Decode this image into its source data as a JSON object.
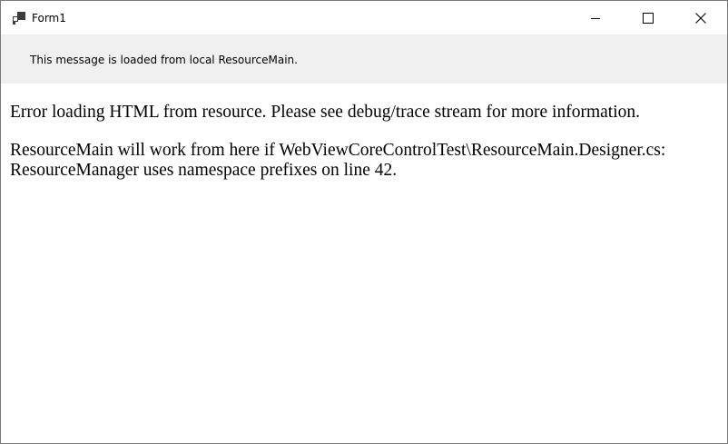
{
  "window": {
    "title": "Form1",
    "icon": "windows-forms-app-icon",
    "controls": {
      "minimize": "minimize-icon",
      "maximize": "maximize-icon",
      "close": "close-icon"
    }
  },
  "info_panel": {
    "message": "This message is loaded from local ResourceMain."
  },
  "browser": {
    "error_line": "Error loading HTML from resource. Please see debug/trace stream for more information.",
    "detail_line_1": "ResourceMain will work from here if WebViewCoreControlTest\\ResourceMain.Designer.cs:",
    "detail_line_2": "ResourceManager uses namespace prefixes on line 42."
  },
  "colors": {
    "titlebar_bg": "#ffffff",
    "panel_bg": "#f0f0f0",
    "border": "#7a7a7a",
    "text": "#000000"
  }
}
